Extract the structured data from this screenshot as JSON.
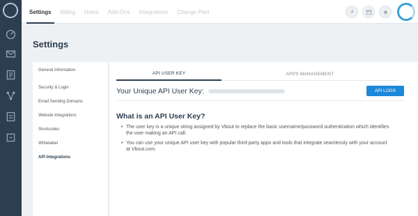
{
  "top_nav": {
    "items": [
      "Settings",
      "Billing",
      "Users",
      "Add-Ons",
      "Integrations",
      "Change Plan"
    ],
    "active_index": 0
  },
  "page": {
    "title": "Settings"
  },
  "side_menu": {
    "items": [
      "General Information",
      "Security & Login",
      "Email Sending Domains",
      "Website Integrations",
      "Shortcodes",
      "Whitelabel",
      "API Integrations"
    ],
    "active_index": 6
  },
  "tabs": {
    "api_user_key": "API USER KEY",
    "apps_management": "APPS MANAGEMENT"
  },
  "api_key": {
    "label": "Your Unique API User Key:",
    "logs_button": "API LOGS"
  },
  "info": {
    "title": "What is an API User Key?",
    "bullets": [
      "The user key is a unique string assigned by Vbout to replace the basic username/password authentication which identifies the user making an API call.",
      "You can use your unique API user key with popular third-party apps and tools that integrate seamlessly with your account at Vbout.com."
    ]
  },
  "colors": {
    "nav_dark": "#2c3e50",
    "accent_blue": "#1e88d8",
    "page_bg": "#eef1f4"
  },
  "icons": {
    "left_nav": [
      "dashboard-icon",
      "email-icon",
      "contacts-icon",
      "workflow-icon",
      "landing-page-icon",
      "social-icon"
    ],
    "top_right": [
      "rocket-icon",
      "calendar-icon",
      "bell-icon"
    ]
  }
}
